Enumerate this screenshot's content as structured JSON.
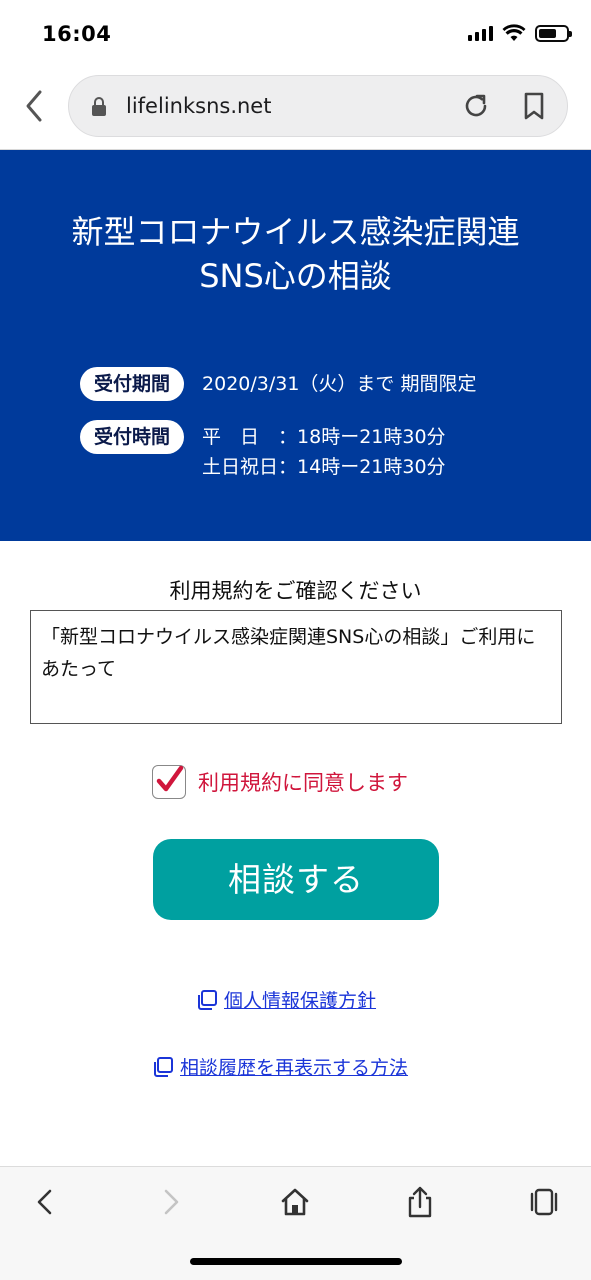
{
  "status_bar": {
    "time": "16:04"
  },
  "browser": {
    "url": "lifelinksns.net"
  },
  "hero": {
    "title_line1": "新型コロナウイルス感染症関連",
    "title_line2": "SNS心の相談",
    "period_label": "受付期間",
    "period_value": "2020/3/31（火）まで 期間限定",
    "time_label": "受付時間",
    "time_weekday": "平　日　：18時ー21時30分",
    "time_weekend": "土日祝日：14時ー21時30分"
  },
  "terms": {
    "heading": "利用規約をご確認ください",
    "text": "「新型コロナウイルス感染症関連SNS心の相談」ご利用にあたって",
    "agree_label": "利用規約に同意します",
    "agree_checked": true
  },
  "actions": {
    "consult_label": "相談する",
    "privacy_link": "個人情報保護方針",
    "history_link": "相談履歴を再表示する方法"
  },
  "colors": {
    "hero_bg": "#003a9b",
    "button_bg": "#00a0a0",
    "agree_text": "#d0163c",
    "link": "#1b35d8"
  }
}
